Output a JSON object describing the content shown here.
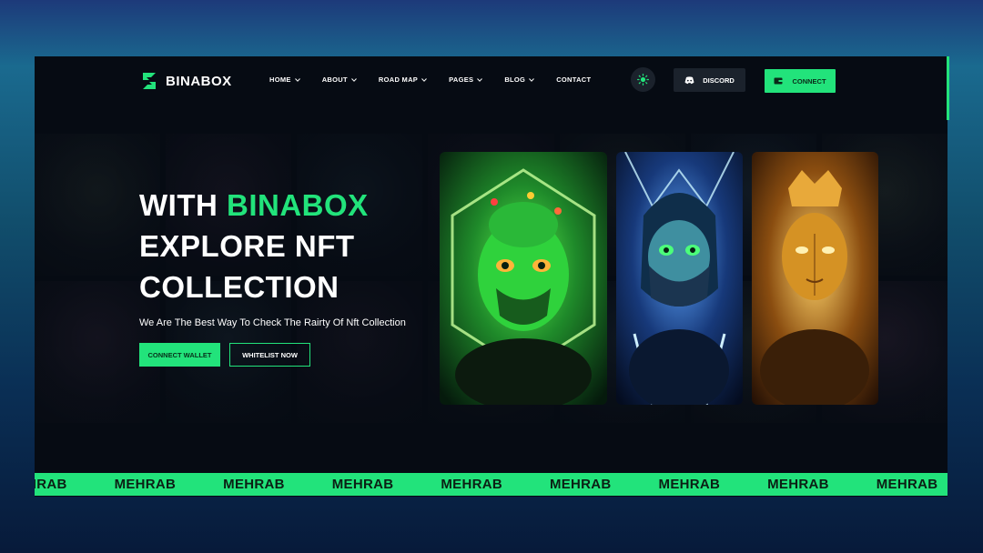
{
  "brand": {
    "name": "BINABOX"
  },
  "nav": {
    "items": [
      {
        "label": "HOME",
        "dropdown": true
      },
      {
        "label": "ABOUT",
        "dropdown": true
      },
      {
        "label": "ROAD MAP",
        "dropdown": true
      },
      {
        "label": "PAGES",
        "dropdown": true
      },
      {
        "label": "BLOG",
        "dropdown": true
      },
      {
        "label": "CONTACT",
        "dropdown": false
      }
    ]
  },
  "header_actions": {
    "theme_icon": "sun-icon",
    "discord_label": "DISCORD",
    "connect_label": "CONNECT"
  },
  "hero": {
    "line1_prefix": "WITH ",
    "line1_accent": "BINABOX",
    "line2": "EXPLORE NFT",
    "line3": "COLLECTION",
    "subtitle": "We Are The Best Way To Check The Rairty Of Nft Collection",
    "primary_button": "CONNECT WALLET",
    "secondary_button": "WHITELIST NOW"
  },
  "cards": [
    {
      "name": "nft-card-green",
      "theme": "#2bd643"
    },
    {
      "name": "nft-card-blue",
      "theme": "#2f6fd8"
    },
    {
      "name": "nft-card-gold",
      "theme": "#d99a1e"
    }
  ],
  "ticker": {
    "items": [
      "MEHRAB",
      "MEHRAB",
      "MEHRAB",
      "MEHRAB",
      "MEHRAB",
      "MEHRAB",
      "MEHRAB",
      "MEHRAB",
      "MEHRAB"
    ]
  },
  "colors": {
    "accent": "#22e37b",
    "background": "#060b13",
    "button_dark": "#1b222c"
  }
}
